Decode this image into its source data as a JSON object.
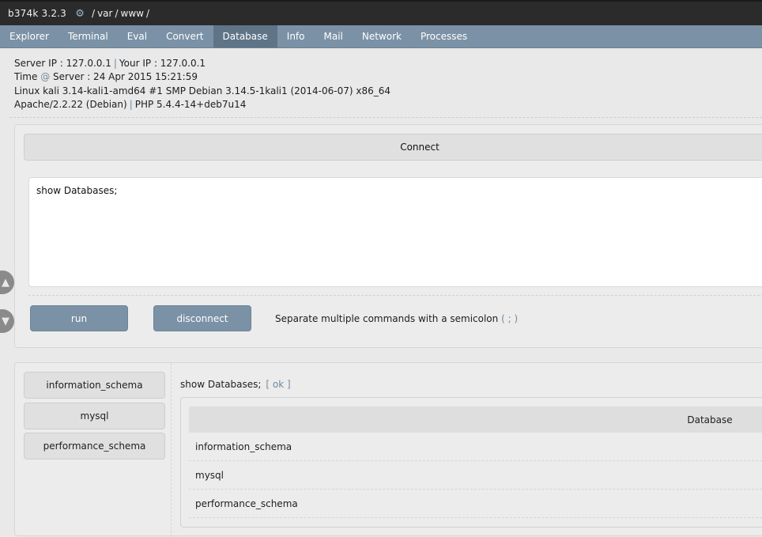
{
  "titlebar": {
    "brand": "b374k 3.2.3",
    "cwd_icon": "gear-icon",
    "cwd": [
      "/",
      "var",
      "/",
      "www",
      "/"
    ]
  },
  "menu": {
    "items": [
      "Explorer",
      "Terminal",
      "Eval",
      "Convert",
      "Database",
      "Info",
      "Mail",
      "Network",
      "Processes"
    ],
    "active": "Database"
  },
  "info": {
    "server_ip_label": "Server IP : 127.0.0.1",
    "your_ip_label": "Your IP : 127.0.0.1",
    "time_label": "Time",
    "server_time": "Server : 24 Apr 2015 15:21:59",
    "uname": "Linux kali 3.14-kali1-amd64 #1 SMP Debian 3.14.5-1kali1 (2014-06-07) x86_64",
    "apache": "Apache/2.2.22 (Debian)",
    "php": "PHP 5.4.4-14+deb7u14"
  },
  "query": {
    "connect_label": "Connect",
    "query_value": "show Databases;",
    "run_label": "run",
    "disconnect_label": "disconnect",
    "hint_text": "Separate multiple commands with a semicolon",
    "hint_semicolon": "( ; )"
  },
  "results": {
    "databases": [
      "information_schema",
      "mysql",
      "performance_schema"
    ],
    "executed_query": "show Databases;",
    "status": "[ ok ]",
    "column_header": "Database",
    "rows": [
      "information_schema",
      "mysql",
      "performance_schema"
    ]
  },
  "colors": {
    "menu_bg": "#7b92a6",
    "menu_active": "#5f7487",
    "titlebar_bg": "#2b2b2b",
    "accent_text": "#6f8aa3"
  }
}
